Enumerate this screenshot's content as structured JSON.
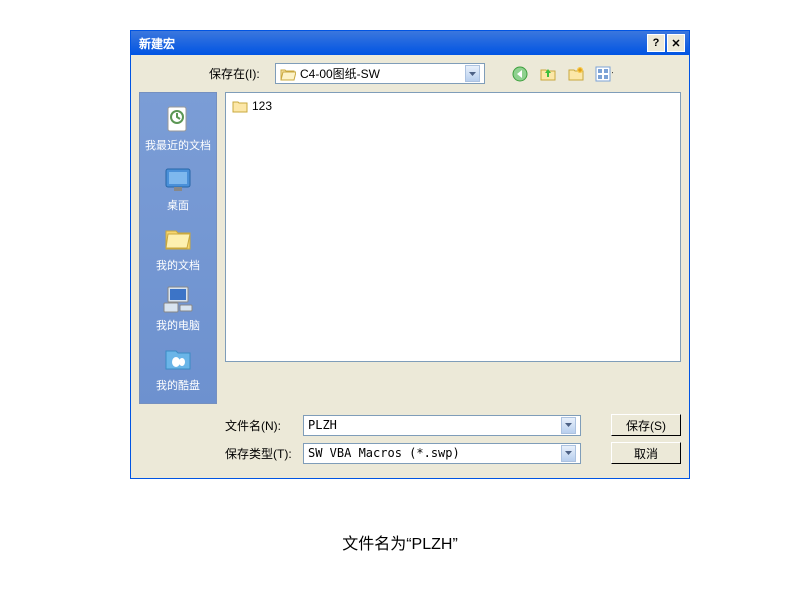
{
  "title": "新建宏",
  "topRow": {
    "label": "保存在(I):",
    "location": "C4-00图纸-SW"
  },
  "sidebar": {
    "items": [
      {
        "label": "我最近的文档"
      },
      {
        "label": "桌面"
      },
      {
        "label": "我的文档"
      },
      {
        "label": "我的电脑"
      },
      {
        "label": "我的酷盘"
      }
    ]
  },
  "fileList": {
    "items": [
      {
        "name": "123"
      }
    ]
  },
  "bottomRows": {
    "filenameLabel": "文件名(N):",
    "filenameValue": "PLZH",
    "typeLabel": "保存类型(T):",
    "typeValue": "SW VBA Macros (*.swp)",
    "saveLabel": "保存(S)",
    "cancelLabel": "取消"
  },
  "caption": "文件名为“PLZH”"
}
